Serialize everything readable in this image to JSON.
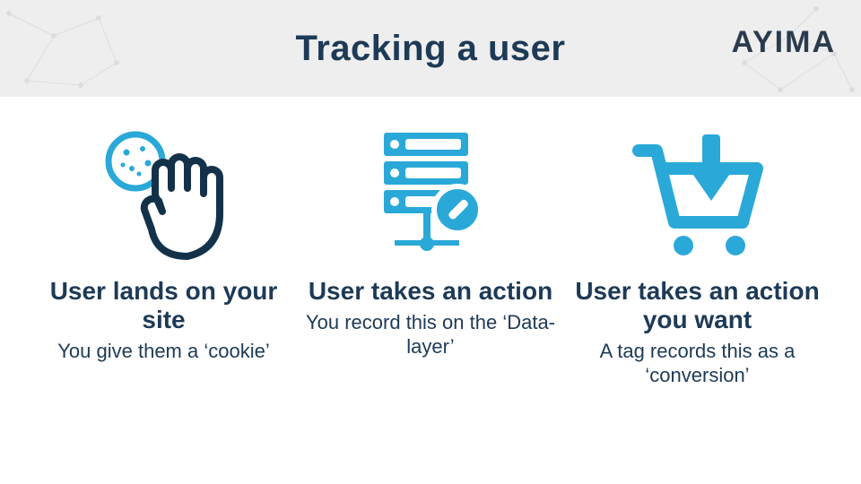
{
  "header": {
    "title": "Tracking a user",
    "brand": "AYIMA"
  },
  "steps": [
    {
      "icon": "cookie-hand-icon",
      "title": "User lands on your site",
      "subtitle": "You give them a ‘cookie’"
    },
    {
      "icon": "server-action-icon",
      "title": "User takes an action",
      "subtitle": "You record this on the ‘Data-layer’"
    },
    {
      "icon": "cart-conversion-icon",
      "title": "User takes an action you want",
      "subtitle": "A tag records this as a ‘conversion’"
    }
  ],
  "colors": {
    "dark": "#1d3a57",
    "accent": "#2aa9d8"
  }
}
